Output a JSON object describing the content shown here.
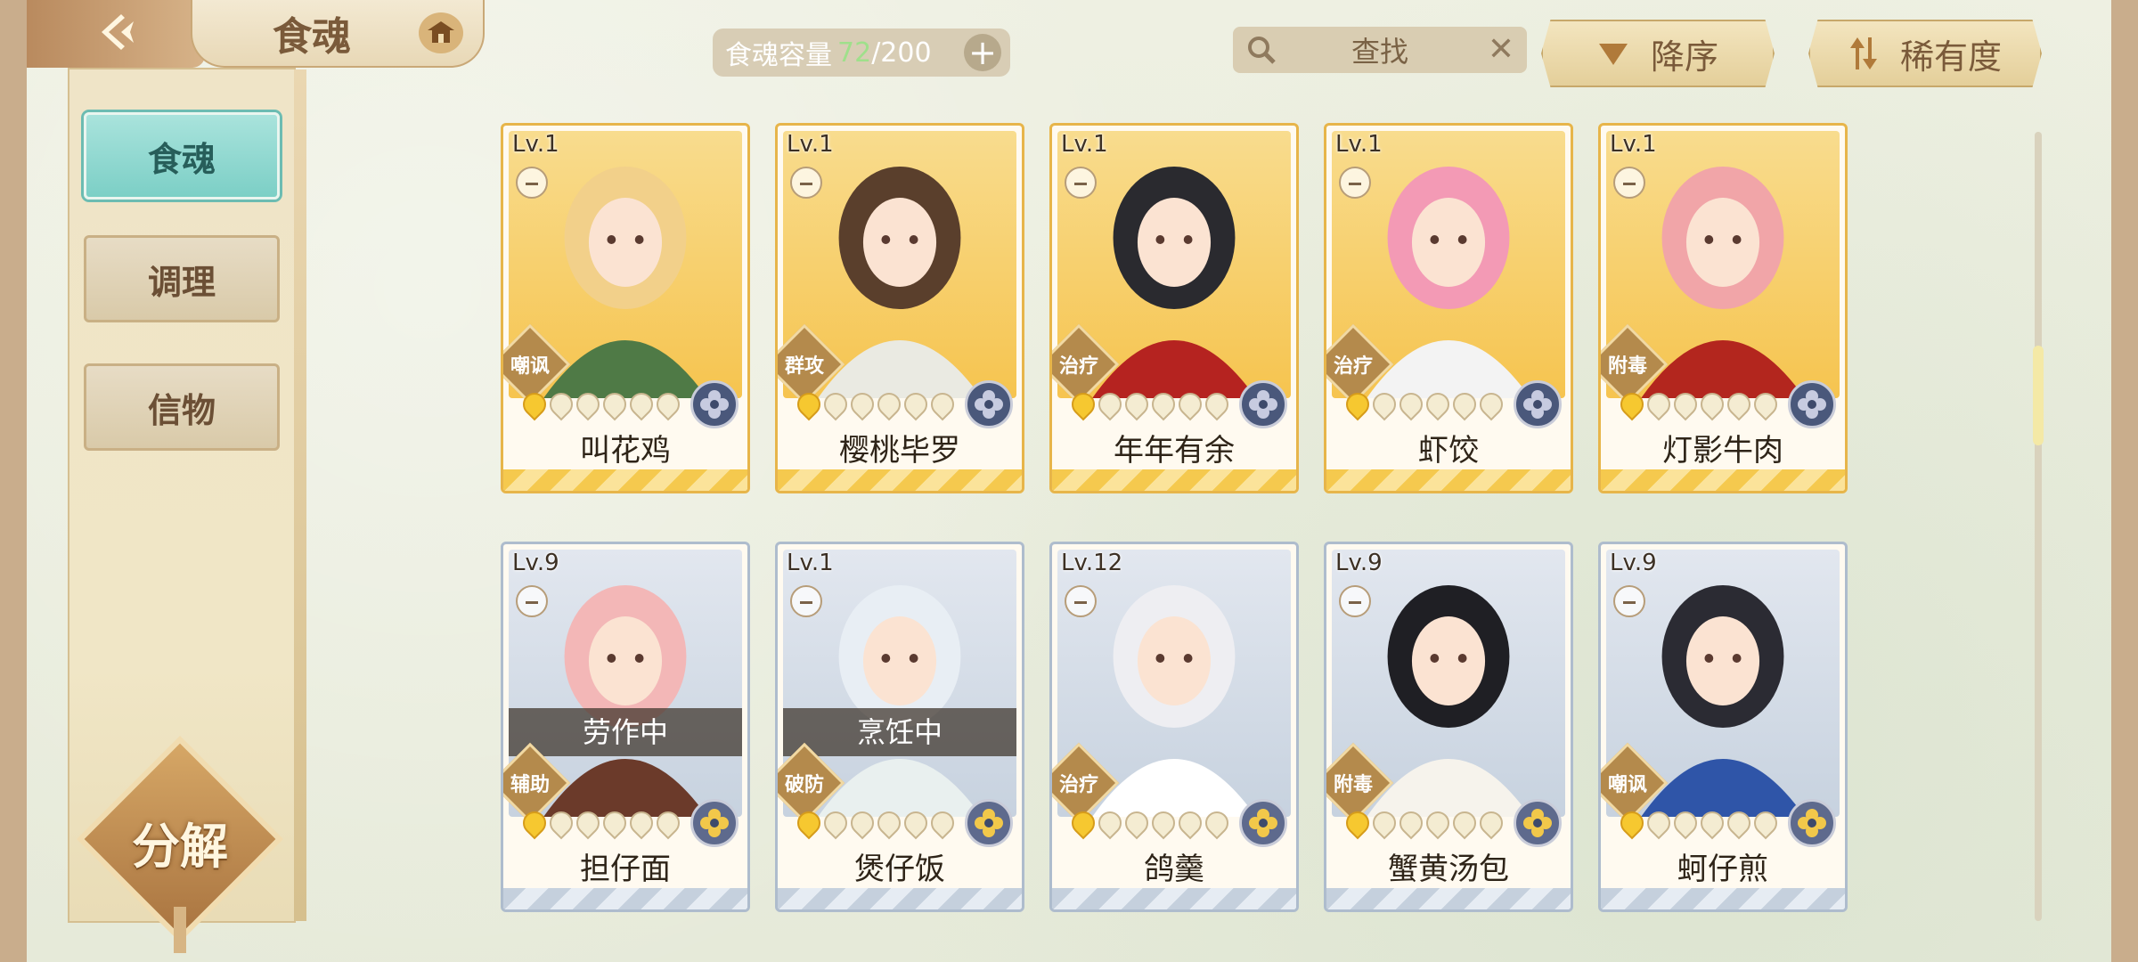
{
  "header": {
    "title": "食魂",
    "back_icon": "back-arrow-icon",
    "home_icon": "pavilion-icon"
  },
  "capacity": {
    "label": "食魂容量",
    "current": "72",
    "total": "/200",
    "plus": "+"
  },
  "search": {
    "placeholder": "查找",
    "clear": "✕"
  },
  "sort": {
    "order_label": "降序",
    "rarity_label": "稀有度"
  },
  "sidebar": {
    "tabs": [
      {
        "label": "食魂",
        "active": true
      },
      {
        "label": "调理",
        "active": false
      },
      {
        "label": "信物",
        "active": false
      }
    ],
    "decompose_label": "分解"
  },
  "cards": [
    {
      "level": "Lv.1",
      "role": "嘲讽",
      "name": "叫花鸡",
      "stars_on": 1,
      "stars_total": 6,
      "frame": "gold",
      "status": ""
    },
    {
      "level": "Lv.1",
      "role": "群攻",
      "name": "樱桃毕罗",
      "stars_on": 1,
      "stars_total": 6,
      "frame": "gold",
      "status": ""
    },
    {
      "level": "Lv.1",
      "role": "治疗",
      "name": "年年有余",
      "stars_on": 1,
      "stars_total": 6,
      "frame": "gold",
      "status": ""
    },
    {
      "level": "Lv.1",
      "role": "治疗",
      "name": "虾饺",
      "stars_on": 1,
      "stars_total": 6,
      "frame": "gold",
      "status": ""
    },
    {
      "level": "Lv.1",
      "role": "附毒",
      "name": "灯影牛肉",
      "stars_on": 1,
      "stars_total": 6,
      "frame": "gold",
      "status": ""
    },
    {
      "level": "Lv.9",
      "role": "辅助",
      "name": "担仔面",
      "stars_on": 1,
      "stars_total": 6,
      "frame": "silver",
      "status": "劳作中"
    },
    {
      "level": "Lv.1",
      "role": "破防",
      "name": "煲仔饭",
      "stars_on": 1,
      "stars_total": 6,
      "frame": "silver",
      "status": "烹饪中"
    },
    {
      "level": "Lv.12",
      "role": "治疗",
      "name": "鸽羹",
      "stars_on": 1,
      "stars_total": 6,
      "frame": "silver",
      "status": ""
    },
    {
      "level": "Lv.9",
      "role": "附毒",
      "name": "蟹黄汤包",
      "stars_on": 1,
      "stars_total": 6,
      "frame": "silver",
      "status": ""
    },
    {
      "level": "Lv.9",
      "role": "嘲讽",
      "name": "蚵仔煎",
      "stars_on": 1,
      "stars_total": 6,
      "frame": "silver",
      "status": ""
    }
  ],
  "colors": {
    "accent_teal": "#7ccfc6",
    "gold_frame": "#e7b54a",
    "silver_frame": "#aebccd",
    "capacity_current": "#9fe08b"
  }
}
